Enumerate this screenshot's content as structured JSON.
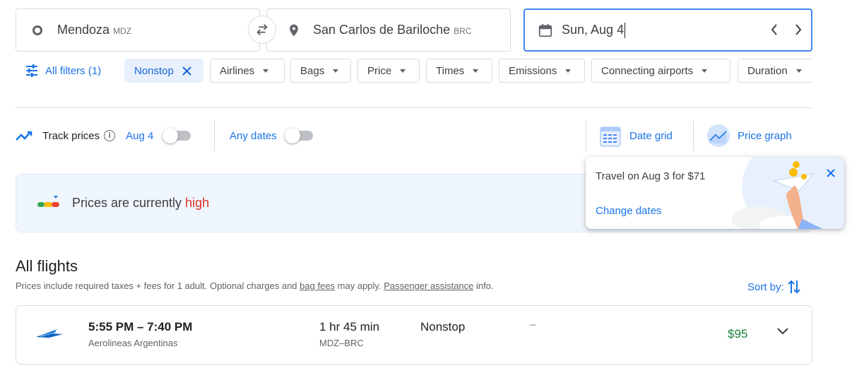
{
  "search": {
    "origin_city": "Mendoza",
    "origin_code": "MDZ",
    "destination_city": "San Carlos de Bariloche",
    "destination_code": "BRC",
    "date": "Sun, Aug 4"
  },
  "filters": {
    "all_filters": "All filters (1)",
    "nonstop": "Nonstop",
    "airlines": "Airlines",
    "bags": "Bags",
    "price": "Price",
    "times": "Times",
    "emissions": "Emissions",
    "connecting_airports": "Connecting airports",
    "duration": "Duration"
  },
  "tracking": {
    "track_prices": "Track prices",
    "track_date": "Aug 4",
    "any_dates": "Any dates",
    "date_grid": "Date grid",
    "price_graph": "Price graph"
  },
  "banner": {
    "prefix": "Prices are currently",
    "level": "high"
  },
  "tip": {
    "message": "Travel on Aug 3 for $71",
    "link": "Change dates"
  },
  "results": {
    "heading": "All flights",
    "note_pre": "Prices include required taxes + fees for 1 adult. Optional charges and",
    "note_link1": "bag fees",
    "note_mid": "may apply.",
    "note_link2": "Passenger assistance",
    "note_post": "info.",
    "sort_by": "Sort by:"
  },
  "flights": [
    {
      "times": "5:55 PM – 7:40 PM",
      "airline": "Aerolineas Argentinas",
      "duration": "1 hr 45 min",
      "route": "MDZ–BRC",
      "stops": "Nonstop",
      "emissions": "–",
      "price": "$95"
    }
  ],
  "colors": {
    "accent": "#1a73e8",
    "high": "#d93025",
    "price": "#188038"
  }
}
